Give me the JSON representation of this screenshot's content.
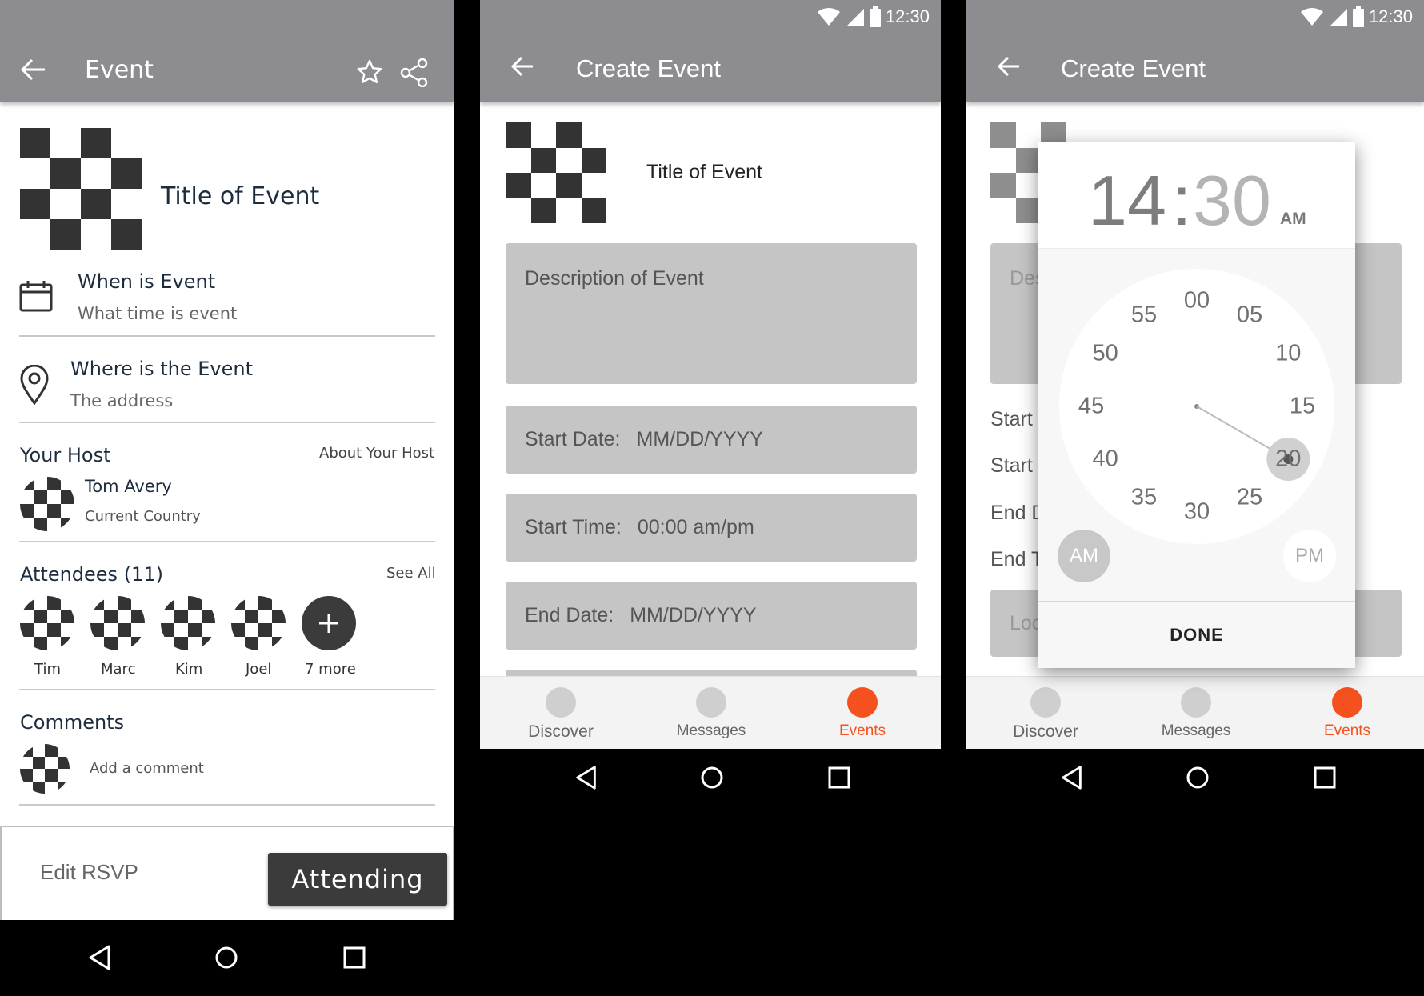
{
  "status_bar": {
    "time": "12:30"
  },
  "event_screen": {
    "title": "Event",
    "event_title": "Title of Event",
    "when": {
      "heading": "When is Event",
      "sub": "What time is event"
    },
    "where": {
      "heading": "Where is the Event",
      "sub": "The address"
    },
    "host": {
      "label": "Your Host",
      "link": "About Your Host",
      "name": "Tom Avery",
      "country": "Current Country"
    },
    "attendees": {
      "label": "Attendees (11)",
      "see_all": "See All",
      "people": [
        "Tim",
        "Marc",
        "Kim",
        "Joel"
      ],
      "more": "7 more"
    },
    "comments": {
      "label": "Comments",
      "placeholder": "Add a comment"
    },
    "rsvp": {
      "edit": "Edit RSVP",
      "attending": "Attending"
    }
  },
  "create_screen": {
    "title": "Create Event",
    "event_title": "Title of Event",
    "description": "Description of Event",
    "start_date": {
      "label": "Start Date:",
      "value": "MM/DD/YYYY"
    },
    "start_time": {
      "label": "Start Time:",
      "value": "00:00 am/pm"
    },
    "end_date": {
      "label": "End Date:",
      "value": "MM/DD/YYYY"
    }
  },
  "picker_screen": {
    "title": "Create Event",
    "bg_desc": "Des",
    "bg_rows": [
      "Start",
      "Start",
      "End D",
      "End T"
    ],
    "bg_loc": "Loc",
    "hours": "14",
    "colon": ":",
    "minutes": "30",
    "ampm_header": "AM",
    "clock_labels": [
      "00",
      "05",
      "10",
      "15",
      "20",
      "25",
      "30",
      "35",
      "40",
      "45",
      "50",
      "55"
    ],
    "selected_minute": 20,
    "am": "AM",
    "pm": "PM",
    "done": "DONE"
  },
  "tabs": {
    "discover": "Discover",
    "messages": "Messages",
    "events": "Events"
  },
  "colors": {
    "accent": "#f4511e",
    "appbar": "#8d8c90",
    "dark_button": "#3a3a3a"
  }
}
